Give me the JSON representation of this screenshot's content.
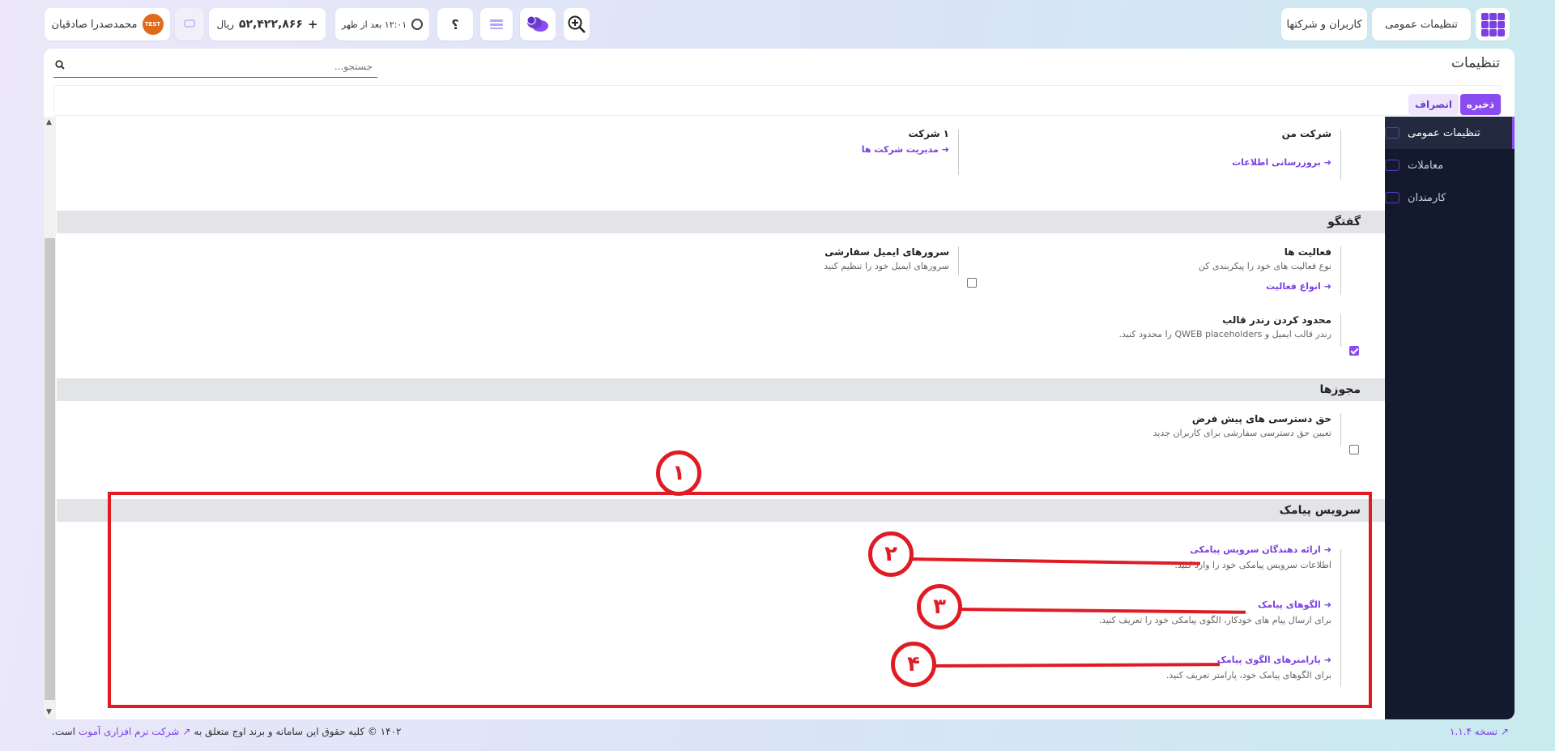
{
  "topbar": {
    "apps_icon": "grid-icon",
    "general_settings": "تنظیمات عمومی",
    "users_companies": "کاربران و شرکتها",
    "user_name": "محمدصدرا صادقیان",
    "test_badge": "TEST",
    "balance": "۵۲,۴۲۲,۸۶۶",
    "currency": "ریال",
    "time_text": "۱۲:۰۱ بعد از ظهر",
    "help_label": "؟"
  },
  "panel": {
    "title": "تنظیمات",
    "search_placeholder": "جستجو...",
    "save": "ذخیره",
    "cancel": "انصراف"
  },
  "sidebar": {
    "items": [
      {
        "label": "تنظیمات عمومی",
        "icon": "gear-icon"
      },
      {
        "label": "معاملات",
        "icon": "money-icon"
      },
      {
        "label": "کارمندان",
        "icon": "users-icon"
      }
    ]
  },
  "companies": {
    "my_company": "شرکت من",
    "update_info": "بروزرسانی اطلاعات",
    "company_count": "۱ شرکت",
    "manage_companies": "مدیریت شرکت ها"
  },
  "discussion": {
    "section": "گفتگو",
    "activities_title": "فعالیت ها",
    "activities_desc": "نوع فعالیت های خود را پیکربندی کن",
    "activity_types": "انواع فعالیت",
    "email_servers_title": "سرورهای ایمیل سفارشی",
    "email_servers_desc": "سرورهای ایمیل خود را تنظیم کنید",
    "restrict_title": "محدود کردن رندر قالب",
    "restrict_desc": "رندر قالب ایمیل و QWEB placeholders را محدود کنید."
  },
  "permissions": {
    "section": "مجوزها",
    "default_access_title": "حق دسترسی های پیش فرض",
    "default_access_desc": "تعیین حق دسترسی سفارشی برای کاربران جدید"
  },
  "sms": {
    "section": "سرویس پیامک",
    "providers": "ارائه دهندگان سرویس پیامکی",
    "providers_desc": "اطلاعات سرویس پیامکی خود را وارد کنید.",
    "templates": "الگوهای پیامک",
    "templates_desc": "برای ارسال پیام های خودکار، الگوی پیامکی خود را تعریف کنید.",
    "params": "پارامترهای الگوی پیامک",
    "params_desc": "برای الگوهای پیامک خود، پارامتر تعریف کنید."
  },
  "annotations": [
    "۱",
    "۲",
    "۳",
    "۴"
  ],
  "footer": {
    "version": "نسخه ۱.۱.۴",
    "copyright": "۱۴۰۲ © کلیه حقوق این سامانه و برند اوج متعلق به",
    "company_link": "شرکت نرم افزاری آموت",
    "suffix": "است."
  },
  "colors": {
    "accent": "#8a4cf0",
    "sidebar": "#141a2e",
    "annotation": "#e01b24"
  }
}
